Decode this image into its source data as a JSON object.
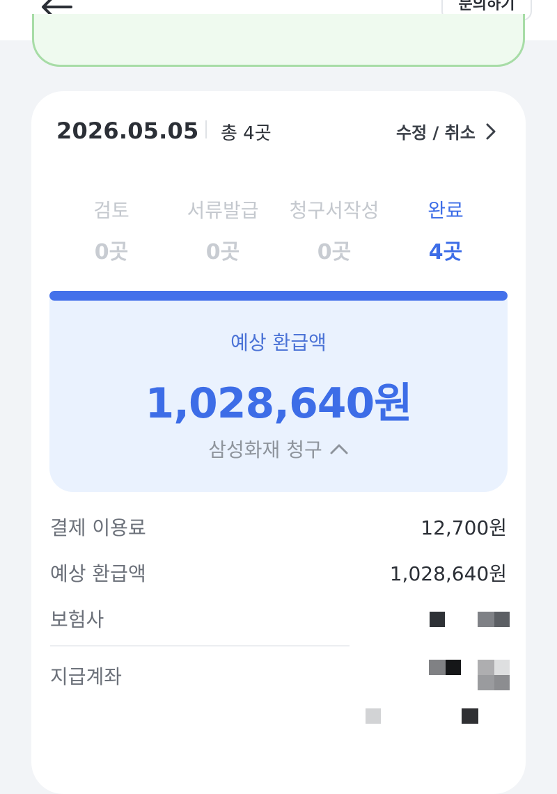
{
  "header": {
    "inquiry_label": "문의하기"
  },
  "summary": {
    "date": "2026.05.05",
    "total": "총 4곳",
    "edit_label": "수정 / 취소"
  },
  "stages": [
    {
      "name": "검토",
      "count": "0곳",
      "active": false
    },
    {
      "name": "서류발급",
      "count": "0곳",
      "active": false
    },
    {
      "name": "청구서작성",
      "count": "0곳",
      "active": false
    },
    {
      "name": "완료",
      "count": "4곳",
      "active": true
    }
  ],
  "progress": {
    "fraction": 1.0
  },
  "refund": {
    "label": "예상 환급액",
    "amount": "1,028,640원",
    "insurer_claim": "삼성화재 청구"
  },
  "details": [
    {
      "label": "결제 이용료",
      "value": "12,700원"
    },
    {
      "label": "예상 환급액",
      "value": "1,028,640원"
    },
    {
      "label": "보험사",
      "value": ""
    },
    {
      "label": "지급계좌",
      "value": ""
    }
  ],
  "colors": {
    "accent": "#3d6de7",
    "banner_border": "#a7dca6",
    "refund_bg": "#eaf2fe"
  }
}
